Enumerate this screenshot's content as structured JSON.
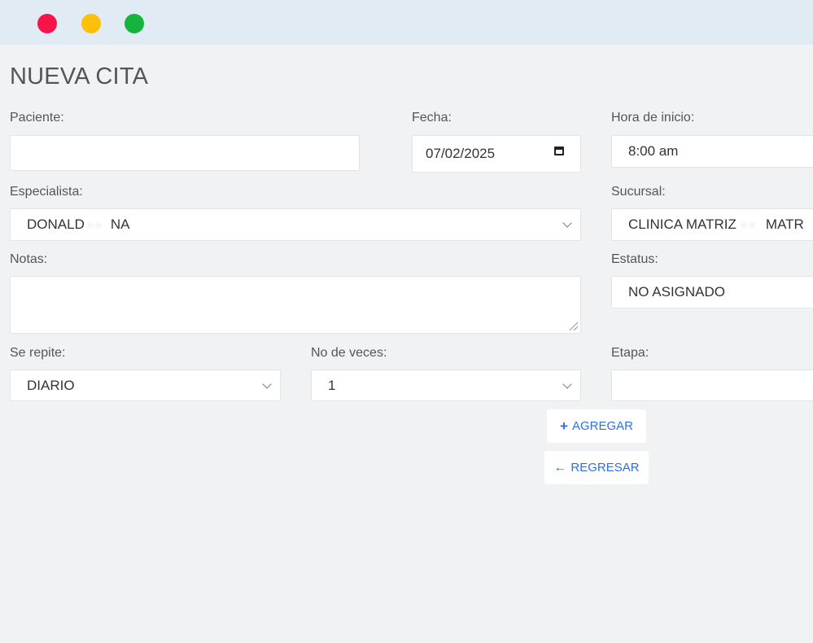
{
  "page": {
    "title": "NUEVA CITA"
  },
  "form": {
    "paciente": {
      "label": "Paciente:",
      "value": ""
    },
    "fecha": {
      "label": "Fecha:",
      "value": "07/02/2025"
    },
    "hora_inicio": {
      "label": "Hora de inicio:",
      "value": "8:00 am"
    },
    "especialista": {
      "label": "Especialista:",
      "value_start": "DONALD",
      "value_hidden": "· ·",
      "value_end": "NA"
    },
    "sucursal": {
      "label": "Sucursal:",
      "value_start": "CLINICA MATRIZ",
      "value_hidden": "· ·",
      "value_end": "MATR"
    },
    "notas": {
      "label": "Notas:",
      "value": ""
    },
    "estatus": {
      "label": "Estatus:",
      "value": "NO ASIGNADO"
    },
    "se_repite": {
      "label": "Se repite:",
      "value": "DIARIO"
    },
    "no_veces": {
      "label": "No de veces:",
      "value": "1"
    },
    "etapa": {
      "label": "Etapa:",
      "value": ""
    }
  },
  "actions": {
    "agregar": {
      "label": "AGREGAR",
      "icon": "plus-icon"
    },
    "regresar": {
      "label": "REGRESAR",
      "icon": "arrow-left-icon"
    }
  },
  "colors": {
    "accent": "#2f6fe4",
    "titlebar": "#e1ebf3",
    "background": "#f1f2f4"
  }
}
